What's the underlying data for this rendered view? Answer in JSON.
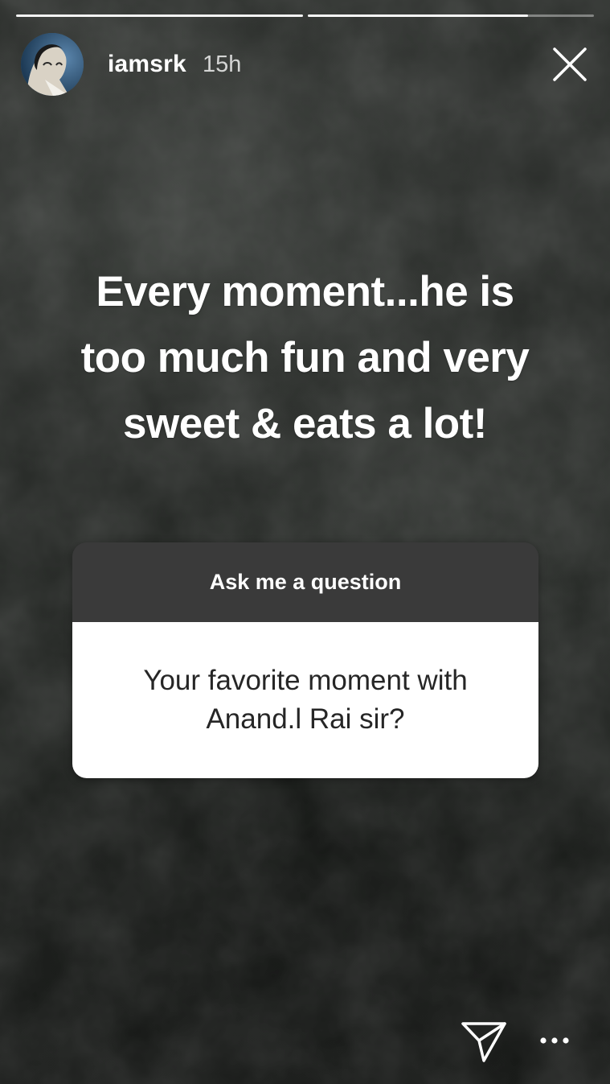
{
  "story": {
    "username": "iamsrk",
    "time": "15h",
    "text_lines": [
      "Every moment...he is",
      "too much fun and very",
      "sweet & eats a lot!"
    ],
    "progress": {
      "segments": 2,
      "current_segment_fraction": 0.77
    }
  },
  "question_sticker": {
    "header": "Ask me a question",
    "question": "Your favorite moment with Anand.l Rai sir?"
  },
  "icons": {
    "close": "close-icon",
    "send": "send-icon",
    "more": "more-icon"
  },
  "colors": {
    "sticker_header_bg": "#3a3a3a",
    "sticker_body_bg": "#ffffff",
    "text": "#ffffff"
  }
}
